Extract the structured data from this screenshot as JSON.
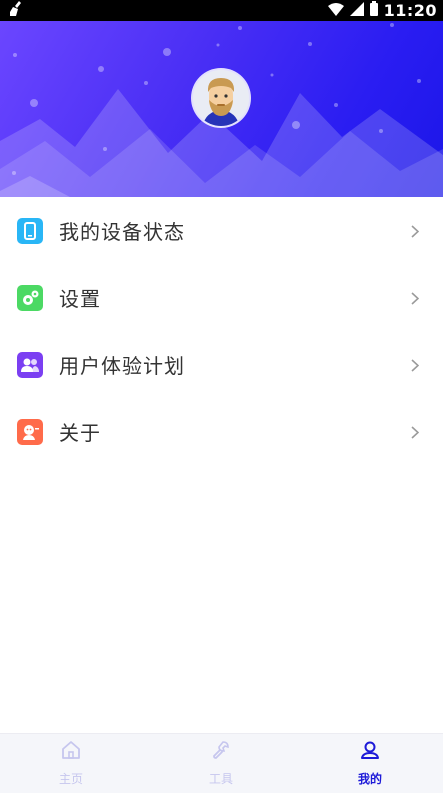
{
  "status_bar": {
    "time": "11:20",
    "left_icon": "broom-icon",
    "icons": [
      "wifi-icon",
      "signal-icon",
      "battery-icon"
    ]
  },
  "header": {
    "gradient": [
      "#6b46ff",
      "#1b16e8"
    ],
    "avatar_icon": "bearded-man-avatar"
  },
  "menu": {
    "items": [
      {
        "label": "我的设备状态",
        "icon": "phone-icon",
        "color": "#29b6f6"
      },
      {
        "label": "设置",
        "icon": "gear-icon",
        "color": "#4cd964"
      },
      {
        "label": "用户体验计划",
        "icon": "users-icon",
        "color": "#7b3ff2"
      },
      {
        "label": "关于",
        "icon": "about-icon",
        "color": "#ff6b4a"
      }
    ]
  },
  "tabbar": {
    "tabs": [
      {
        "label": "主页",
        "icon": "home-icon",
        "active": false
      },
      {
        "label": "工具",
        "icon": "wrench-icon",
        "active": false
      },
      {
        "label": "我的",
        "icon": "user-icon",
        "active": true
      }
    ],
    "active_color": "#1d1ad8",
    "inactive_color": "#c6c6ee"
  }
}
